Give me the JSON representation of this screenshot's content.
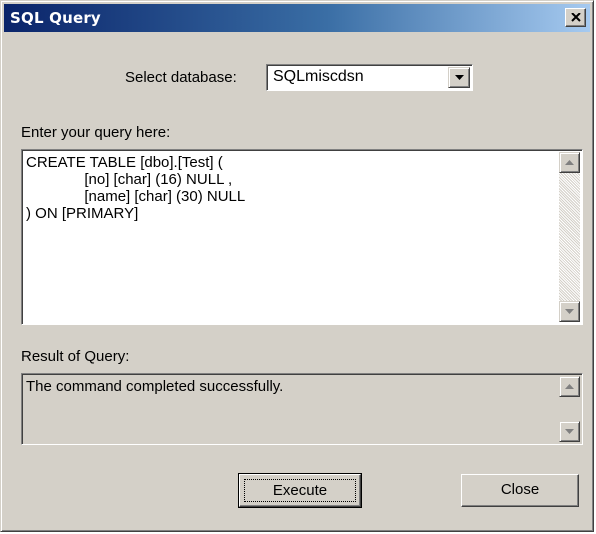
{
  "window": {
    "title": "SQL Query"
  },
  "database": {
    "label": "Select database:",
    "selected": "SQLmiscdsn"
  },
  "query": {
    "label": "Enter your query here:",
    "text": "CREATE TABLE [dbo].[Test] (\n              [no] [char] (16) NULL ,\n              [name] [char] (30) NULL\n) ON [PRIMARY]"
  },
  "result": {
    "label": "Result of Query:",
    "text": "The command completed successfully."
  },
  "buttons": {
    "execute": "Execute",
    "close": "Close"
  },
  "colors": {
    "titlebar_start": "#0a246a",
    "titlebar_end": "#a6caf0",
    "face": "#d4d0c8"
  }
}
